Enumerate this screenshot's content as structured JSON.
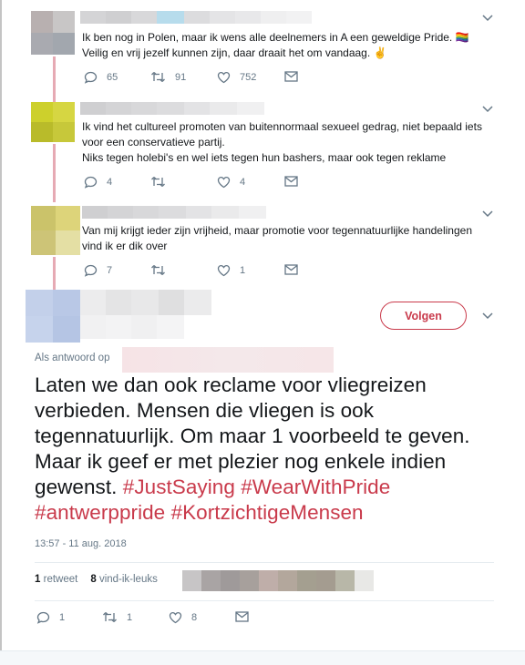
{
  "tweets": [
    {
      "text": "Ik ben nog in Polen, maar ik wens alle deelnemers in A een geweldige Pride. 🏳️‍🌈\nVeilig en vrij jezelf kunnen zijn, daar draait het om vandaag. ✌️",
      "replies": "65",
      "retweets": "91",
      "likes": "752"
    },
    {
      "text": "Ik vind het cultureel promoten van buitennormaal sexueel gedrag, niet bepaald iets voor een conservatieve partij.\nNiks tegen holebi's en wel iets tegen hun bashers, maar ook tegen reklame",
      "replies": "4",
      "retweets": "",
      "likes": "4"
    },
    {
      "text": "Van mij krijgt ieder zijn vrijheid, maar promotie voor tegennatuurlijke handelingen vind ik er dik over",
      "replies": "7",
      "retweets": "",
      "likes": "1"
    }
  ],
  "main": {
    "follow_label": "Volgen",
    "reply_to_label": "Als antwoord op",
    "text_plain": "Laten we dan ook reclame voor vliegreizen verbieden. Mensen die vliegen is ook tegennatuurlijk. Om maar 1 voorbeeld te geven. Maar ik geef er met plezier nog enkele indien gewenst.",
    "hashtags": [
      "#JustSaying",
      "#WearWithPride",
      "#antwerppride",
      "#KortzichtigeMensen"
    ],
    "timestamp": "13:57 - 11 aug. 2018",
    "retweet_count": "1",
    "retweet_label": "retweet",
    "like_count": "8",
    "like_label": "vind-ik-leuks",
    "actions": {
      "replies": "1",
      "retweets": "1",
      "likes": "8"
    }
  },
  "colors": {
    "accent": "#c93a4b",
    "thread_line": "#e6aab4",
    "muted": "#657786"
  }
}
